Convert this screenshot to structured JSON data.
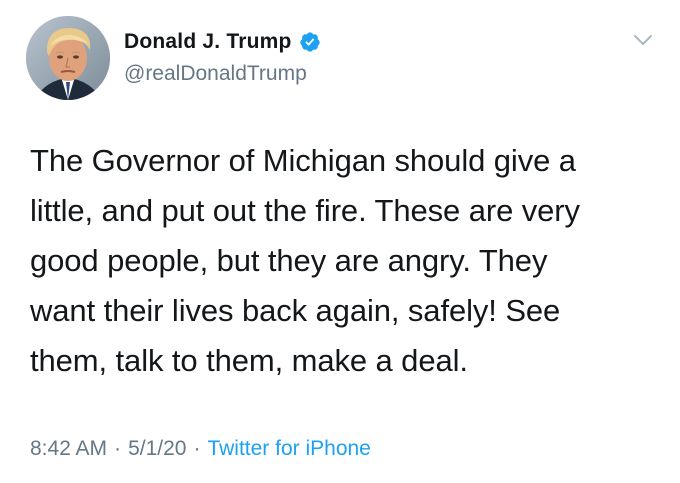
{
  "tweet": {
    "author": {
      "display_name": "Donald J. Trump",
      "handle": "@realDonaldTrump",
      "verified": true,
      "avatar_icon": "profile-photo"
    },
    "text": "The Governor of Michigan should give a\nlittle, and put out the fire. These are very\ngood people, but they are angry. They\nwant their lives back again, safely! See\nthem, talk to them, make a deal.",
    "meta": {
      "time": "8:42 AM",
      "separator": "·",
      "date": "5/1/20",
      "source": "Twitter for iPhone"
    },
    "menu_icon": "chevron-down-icon"
  },
  "colors": {
    "text": "#14171a",
    "secondary": "#657786",
    "accent": "#1da1f2",
    "background": "#ffffff"
  }
}
